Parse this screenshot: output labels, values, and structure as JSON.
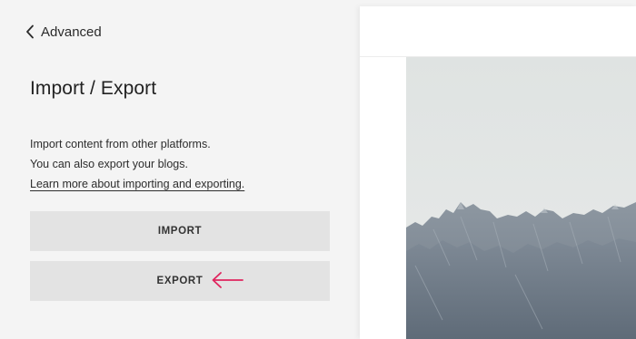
{
  "nav": {
    "back_label": "Advanced",
    "back_icon": "chevron-left-icon"
  },
  "page": {
    "title": "Import / Export"
  },
  "description": {
    "line1": "Import content from other platforms.",
    "line2": "You can also export your blogs.",
    "link": "Learn more about importing and exporting."
  },
  "buttons": {
    "import_label": "IMPORT",
    "export_label": "EXPORT"
  },
  "annotation": {
    "arrow_icon": "left-arrow-icon",
    "arrow_color": "#e0245e"
  },
  "colors": {
    "panel_bg": "#f4f4f4",
    "button_bg": "#e3e3e3",
    "preview_bg": "#ffffff"
  }
}
